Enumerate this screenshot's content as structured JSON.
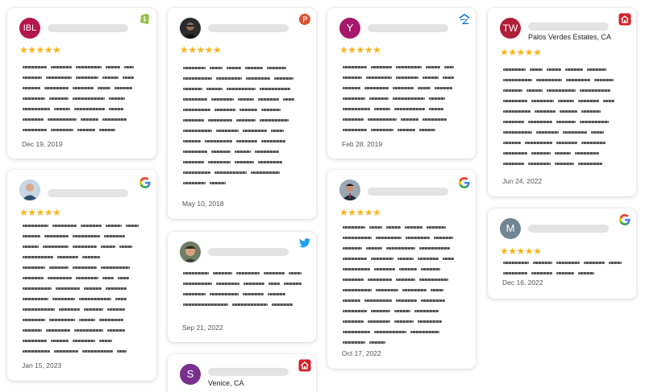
{
  "colors": {
    "star": "#f8b317",
    "name_placeholder": "#e3e3e3",
    "avatar_ibl": "#b4174a",
    "avatar_y": "#a6176a",
    "avatar_tw": "#b02038",
    "avatar_m": "#6f8591",
    "avatar_s": "#7a2f8c"
  },
  "reviews": [
    {
      "avatar_text": "IBL",
      "source": "shopify-icon",
      "stars": "★★★★★",
      "date": "Dec 19, 2019"
    },
    {
      "avatar_text": "",
      "source": "google-icon",
      "stars": "★★★★★",
      "date": "Jan 15, 2023"
    },
    {
      "avatar_text": "",
      "source": "producthunt-icon",
      "stars": "★★★★★",
      "date": "May 10, 2018"
    },
    {
      "avatar_text": "",
      "source": "twitter-icon",
      "stars": "★★★★★",
      "date": "Sep 21, 2022"
    },
    {
      "avatar_text": "S",
      "source": "homeadvisor-icon",
      "location": "Venice, CA"
    },
    {
      "avatar_text": "Y",
      "source": "zillow-icon",
      "stars": "★★★★★",
      "date": "Feb 28, 2019"
    },
    {
      "avatar_text": "",
      "source": "google-icon",
      "stars": "★★★★★",
      "date": "Oct 17, 2022"
    },
    {
      "avatar_text": "TW",
      "source": "homeadvisor-icon",
      "location": "Palos Verdes Estates, CA",
      "stars": "★★★★★",
      "date": "Jun 24, 2022"
    },
    {
      "avatar_text": "M",
      "source": "google-icon",
      "stars": "★★★★★",
      "date": "Dec 16, 2022"
    }
  ]
}
